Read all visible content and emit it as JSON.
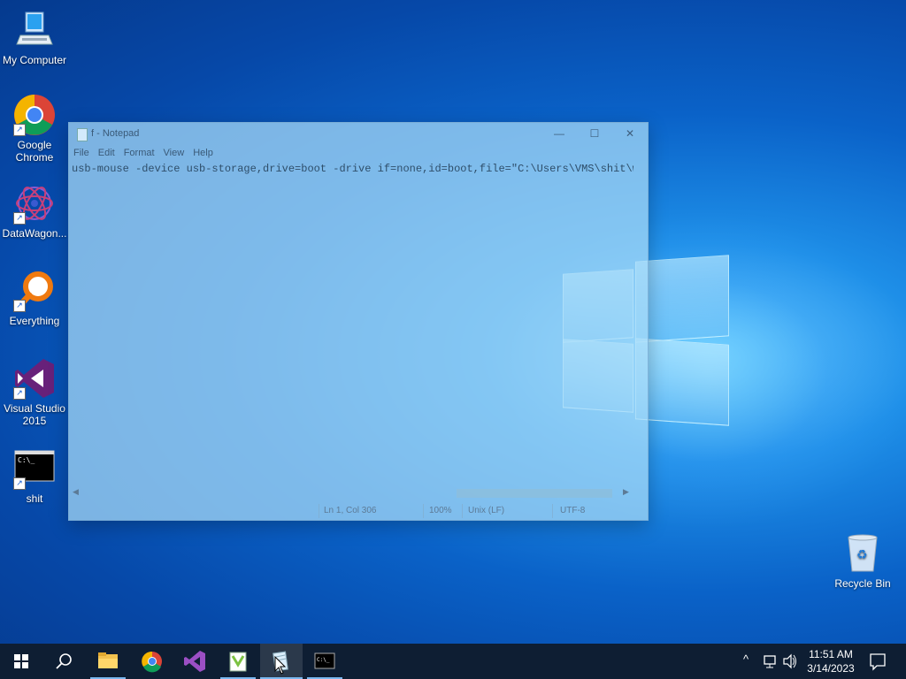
{
  "desktop": {
    "icons": [
      {
        "label": "My Computer",
        "icon": "computer-icon"
      },
      {
        "label": "Google Chrome",
        "icon": "chrome-icon"
      },
      {
        "label": "DataWagon...",
        "icon": "datawagon-icon"
      },
      {
        "label": "Everything",
        "icon": "everything-search-icon"
      },
      {
        "label": "Visual Studio 2015",
        "icon": "visual-studio-icon"
      },
      {
        "label": "shit",
        "icon": "console-icon"
      },
      {
        "label": "Recycle Bin",
        "icon": "recycle-bin-icon"
      }
    ]
  },
  "notepad": {
    "title": "f - Notepad",
    "menu": [
      "File",
      "Edit",
      "Format",
      "View",
      "Help"
    ],
    "content": "usb-mouse -device usb-storage,drive=boot -drive if=none,id=boot,file=\"C:\\Users\\VMS\\shit\\woa",
    "status": {
      "position": "Ln 1, Col 306",
      "zoom": "100%",
      "line_ending": "Unix (LF)",
      "encoding": "UTF-8"
    },
    "window_buttons": {
      "minimize": "—",
      "maximize": "☐",
      "close": "✕"
    }
  },
  "taskbar": {
    "apps": [
      "start-icon",
      "search-icon",
      "file-explorer-icon",
      "chrome-icon",
      "visual-studio-icon",
      "notepad-plus-icon",
      "notepad-icon",
      "console-icon"
    ],
    "clock": {
      "time": "11:51 AM",
      "date": "3/14/2023"
    },
    "tray_chevron": "^"
  },
  "colors": {
    "accent": "#0a62c8",
    "taskbar": "#0e1e33"
  }
}
